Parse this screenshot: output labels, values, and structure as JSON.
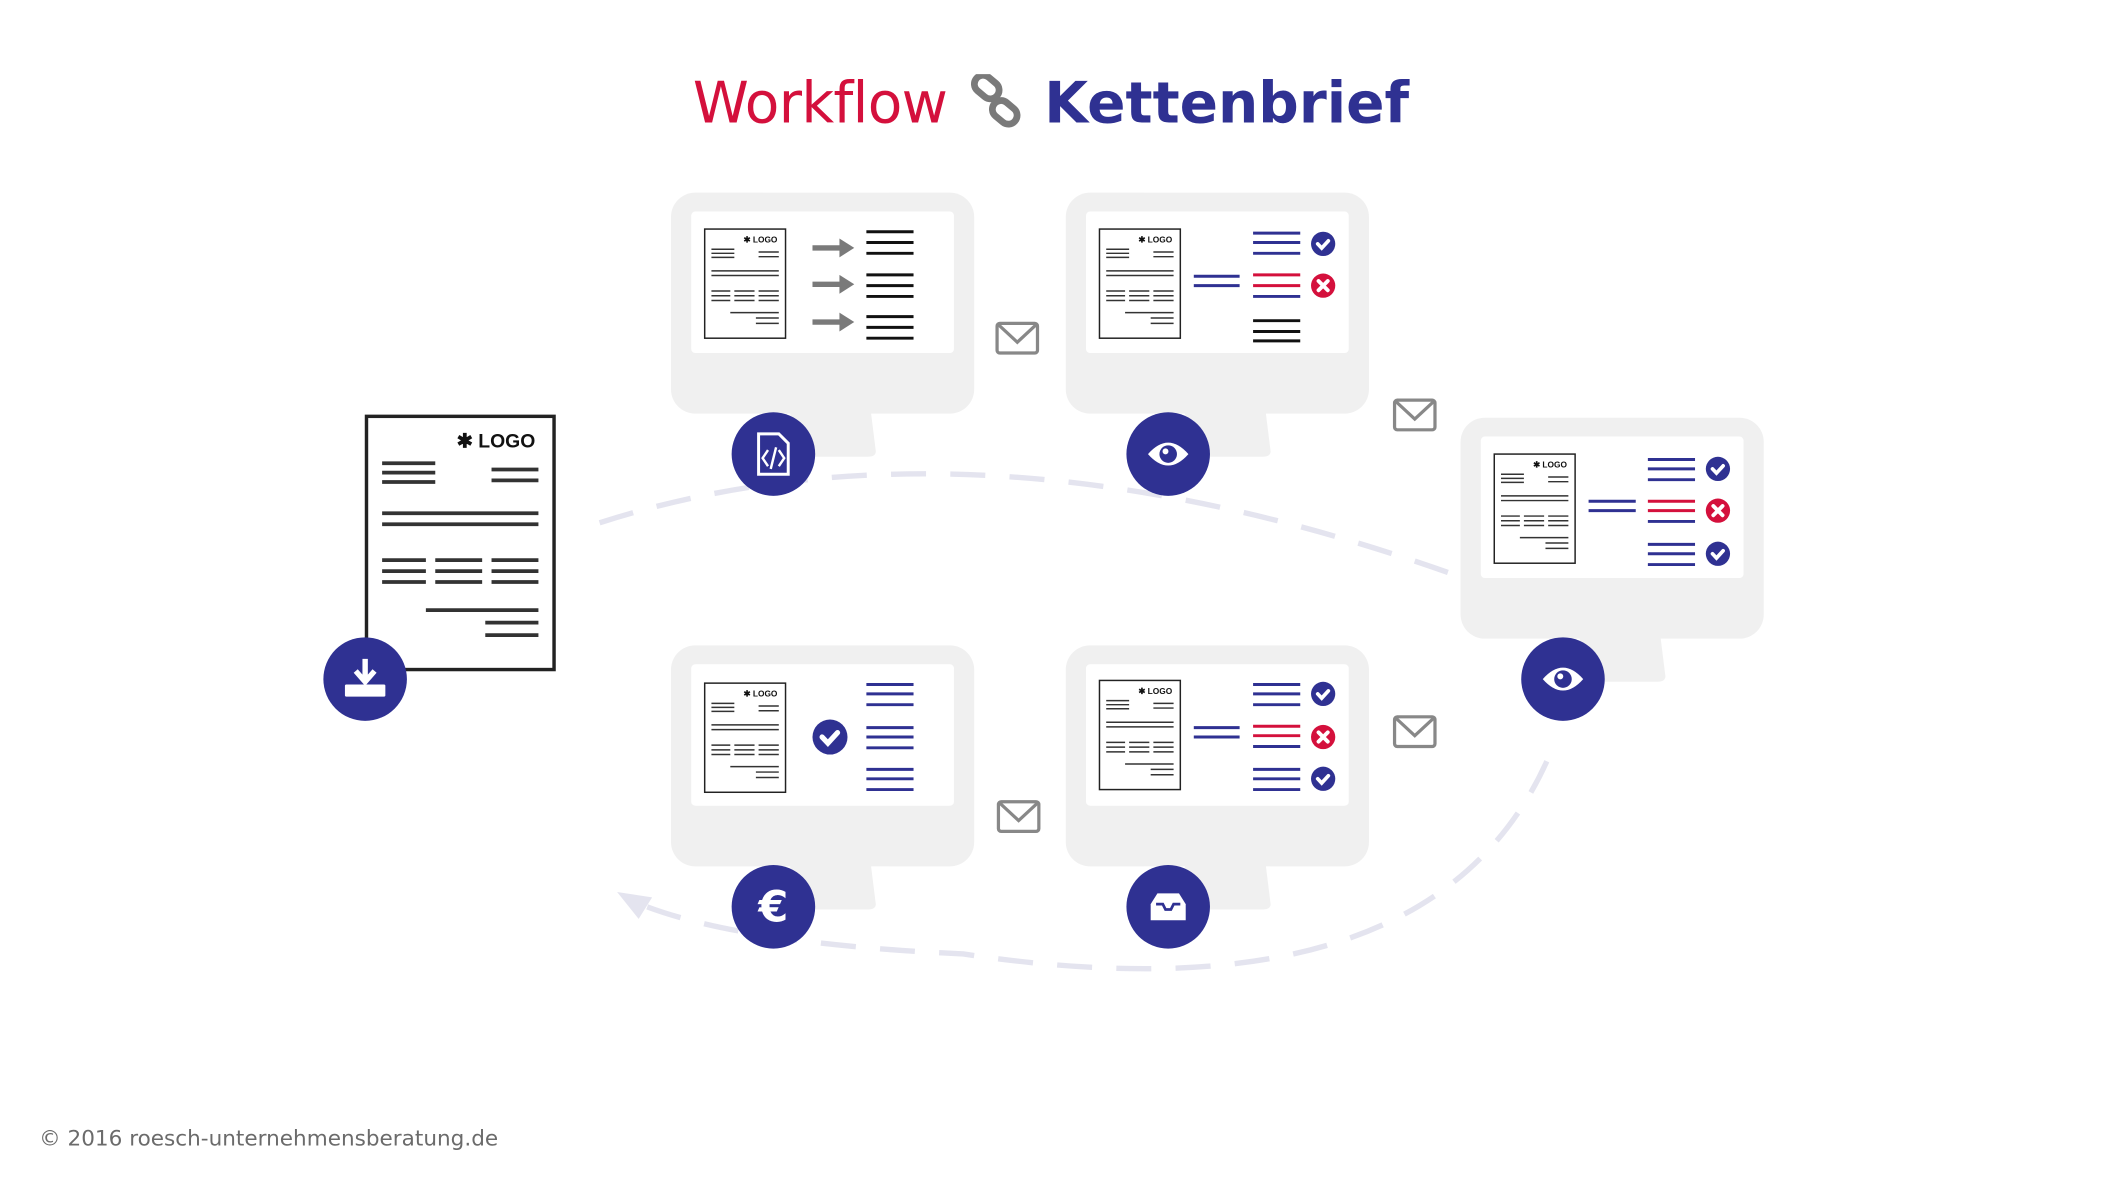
{
  "title": {
    "part1": "Workflow",
    "part2": "Kettenbrief",
    "separator_icon": "chain-link-icon"
  },
  "colors": {
    "red": "#d4103c",
    "navy": "#2f3192",
    "monitor": "#f0f0f0",
    "gray": "#7a7a7a",
    "dash": "#e4e4ef"
  },
  "document": {
    "logo_text": "LOGO",
    "logo_mark": "✱"
  },
  "steps": [
    {
      "id": "download",
      "icon": "download-icon"
    },
    {
      "id": "convert",
      "icon": "file-code-icon"
    },
    {
      "id": "review-1",
      "icon": "eye-icon"
    },
    {
      "id": "review-2",
      "icon": "eye-icon"
    },
    {
      "id": "inbox",
      "icon": "inbox-icon"
    },
    {
      "id": "payment",
      "icon": "euro-icon",
      "glyph": "€"
    }
  ],
  "footer": "© 2016 roesch-unternehmensberatung.de"
}
